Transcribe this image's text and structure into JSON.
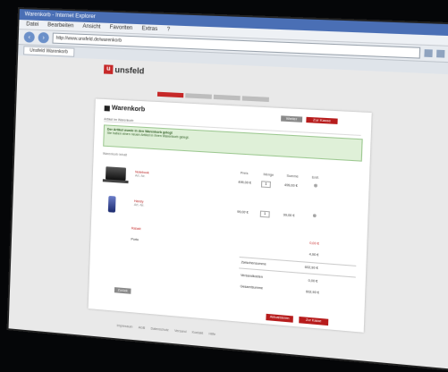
{
  "browser": {
    "title": "Warenkorb - Internet Explorer",
    "menu": [
      "Datei",
      "Bearbeiten",
      "Ansicht",
      "Favoriten",
      "Extras",
      "?"
    ],
    "url": "http://www.unsfeld.de/warenkorb",
    "tab": "Unsfeld Warenkorb"
  },
  "site": {
    "logo_mark": "u",
    "logo_name": "unsfeld"
  },
  "cart": {
    "title": "Warenkorb",
    "btn_continue": "Weiter einkaufen",
    "btn_checkout": "Zur Kasse",
    "info": "Artikel im Warenkorb",
    "alert_head": "Der Artikel wurde in den Warenkorb gelegt",
    "alert_text": "Sie haben einen neuen Artikel in Ihren Warenkorb gelegt.",
    "section_label": "Warenkorb Inhalt",
    "columns": [
      "Preis",
      "Menge",
      "Summe",
      "Entf."
    ],
    "items": [
      {
        "name": "Notebook",
        "sub": "Art.-Nr.",
        "price": "499,00 €",
        "qty": "1",
        "total": "499,00 €"
      },
      {
        "name": "Handy",
        "sub": "Art.-Nr.",
        "price": "99,00 €",
        "qty": "1",
        "total": "99,00 €"
      }
    ],
    "extra1_label": "Rabatt",
    "extra1_value": "0,00 €",
    "extra2_label": "Porto",
    "extra2_value": "4,90 €",
    "subtotal_label": "Zwischensumme",
    "subtotal_value": "602,90 €",
    "shipping_label": "Versandkosten",
    "shipping_value": "0,00 €",
    "grand_label": "Gesamtsumme",
    "grand_value": "602,90 €",
    "back_label": "Zurück",
    "bottom_btn1": "Aktualisieren",
    "bottom_btn2": "Zur Kasse"
  },
  "footer": [
    "Impressum",
    "AGB",
    "Datenschutz",
    "Versand",
    "Kontakt",
    "Hilfe"
  ]
}
